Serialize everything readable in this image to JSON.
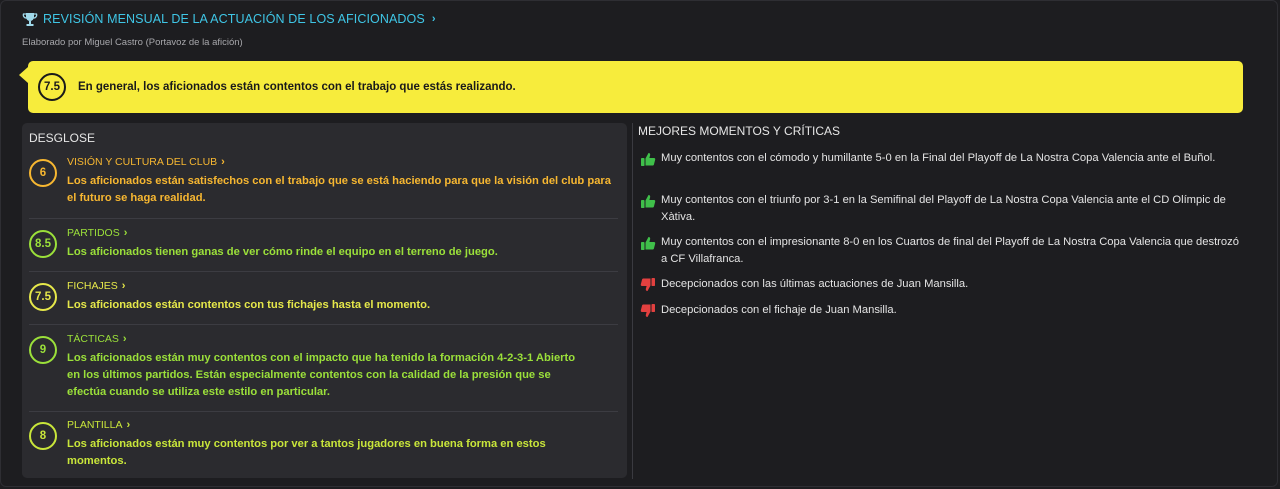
{
  "header": {
    "title": "REVISIÓN MENSUAL DE LA ACTUACIÓN DE LOS AFICIONADOS",
    "subtitle": "Elaborado por Miguel Castro (Portavoz de la afición)"
  },
  "summary": {
    "rating": "7.5",
    "text": "En general, los aficionados están contentos con el trabajo que estás realizando."
  },
  "breakdown": {
    "title": "DESGLOSE",
    "items": [
      {
        "rating": "6",
        "label": "VISIÓN Y CULTURA DEL CLUB",
        "color": "#f7b731",
        "desc": "Los aficionados están satisfechos con el trabajo que se está haciendo para que la visión del club para el futuro se haga realidad."
      },
      {
        "rating": "8.5",
        "label": "PARTIDOS",
        "color": "#9be03a",
        "desc": "Los aficionados tienen ganas de ver cómo rinde el equipo en el terreno de juego."
      },
      {
        "rating": "7.5",
        "label": "FICHAJES",
        "color": "#e6e84a",
        "desc": "Los aficionados están contentos con tus fichajes hasta el momento."
      },
      {
        "rating": "9",
        "label": "TÁCTICAS",
        "color": "#9be03a",
        "desc": "Los aficionados están muy contentos con el impacto que ha tenido la formación 4-2-3-1 Abierto en los últimos partidos. Están especialmente contentos con la calidad de la presión que se efectúa cuando se utiliza este estilo en particular."
      },
      {
        "rating": "8",
        "label": "PLANTILLA",
        "color": "#c9e63a",
        "desc": "Los aficionados están muy contentos por ver a tantos jugadores en buena forma en estos momentos."
      }
    ]
  },
  "moments": {
    "title": "MEJORES MOMENTOS Y CRÍTICAS",
    "items": [
      {
        "type": "thumbs-up",
        "text": "Muy contentos con el cómodo y humillante 5-0 en la Final del Playoff de La Nostra Copa Valencia ante el Buñol."
      },
      {
        "type": "thumbs-up",
        "text": "Muy contentos con el triunfo por 3-1 en la Semifinal del Playoff de La Nostra Copa Valencia ante el CD Olímpic de Xàtiva."
      },
      {
        "type": "thumbs-up",
        "text": "Muy contentos con el impresionante 8-0 en los Cuartos de final del Playoff de La Nostra Copa Valencia que destrozó a CF Villafranca."
      },
      {
        "type": "thumbs-down",
        "text": "Decepcionados con las últimas actuaciones de Juan Mansilla."
      },
      {
        "type": "thumbs-down",
        "text": "Decepcionados con el fichaje de Juan Mansilla."
      }
    ]
  },
  "colors": {
    "accent": "#3fc6e6",
    "summary_bg": "#f7ec3c",
    "positive": "#3fbf4a",
    "negative": "#e2403f"
  }
}
